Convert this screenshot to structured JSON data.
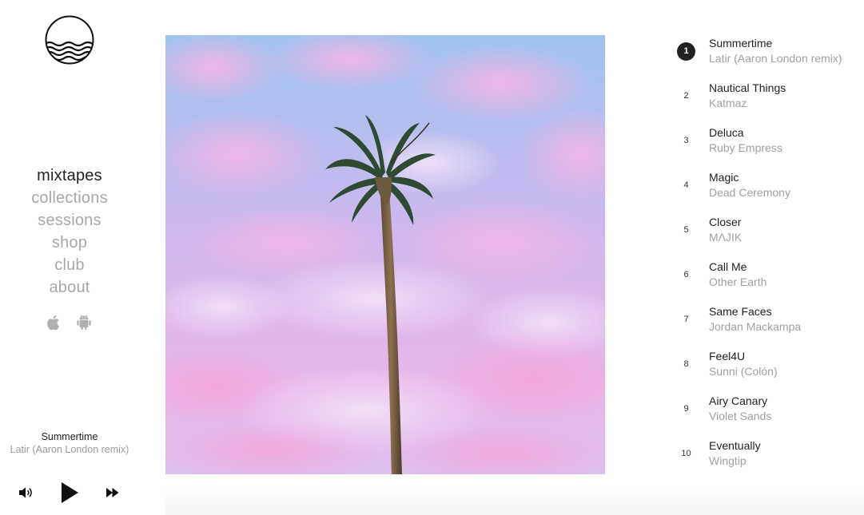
{
  "nav": {
    "items": [
      {
        "label": "mixtapes",
        "active": true
      },
      {
        "label": "collections",
        "active": false
      },
      {
        "label": "sessions",
        "active": false
      },
      {
        "label": "shop",
        "active": false
      },
      {
        "label": "club",
        "active": false
      },
      {
        "label": "about",
        "active": false
      }
    ]
  },
  "apps": {
    "icons": [
      "apple-icon",
      "android-icon"
    ]
  },
  "now_playing": {
    "title": "Summertime",
    "artist": "Latir (Aaron London remix)"
  },
  "player": {
    "icons": [
      "volume-icon",
      "play-icon",
      "next-icon"
    ]
  },
  "tracklist": {
    "tracks": [
      {
        "number": "1",
        "title": "Summertime",
        "artist": "Latir (Aaron London remix)",
        "active": true
      },
      {
        "number": "2",
        "title": "Nautical Things",
        "artist": "Katmaz",
        "active": false
      },
      {
        "number": "3",
        "title": "Deluca",
        "artist": "Ruby Empress",
        "active": false
      },
      {
        "number": "4",
        "title": "Magic",
        "artist": "Dead Ceremony",
        "active": false
      },
      {
        "number": "5",
        "title": "Closer",
        "artist": "MΛJIK",
        "active": false
      },
      {
        "number": "6",
        "title": "Call Me",
        "artist": "Other Earth",
        "active": false
      },
      {
        "number": "7",
        "title": "Same Faces",
        "artist": "Jordan Mackampa",
        "active": false
      },
      {
        "number": "8",
        "title": "Feel4U",
        "artist": "Sunni (Colón)",
        "active": false
      },
      {
        "number": "9",
        "title": "Airy Canary",
        "artist": "Violet Sands",
        "active": false
      },
      {
        "number": "10",
        "title": "Eventually",
        "artist": "Wingtip",
        "active": false
      }
    ]
  },
  "colors": {
    "text": "#222222",
    "muted": "#a8a8a8",
    "sky_pink": "#e8a9e6",
    "sky_blue": "#8ec6ea"
  }
}
